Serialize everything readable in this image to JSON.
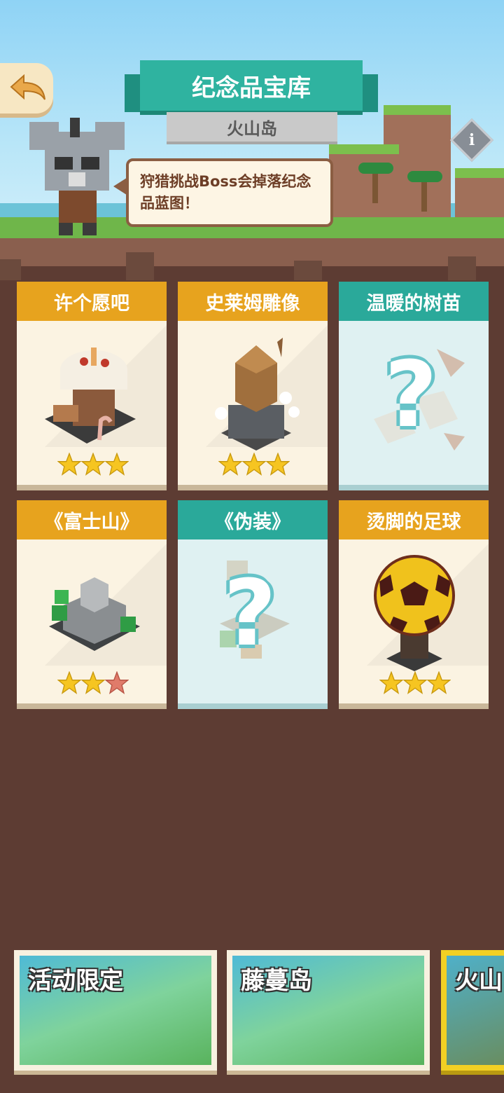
{
  "header": {
    "title": "纪念品宝库",
    "subtitle": "火山岛",
    "info_label": "i",
    "speech": "狩猎挑战Boss会掉落纪念品蓝图！"
  },
  "souvenirs": [
    {
      "name": "许个愿吧",
      "stars_earned": 3,
      "stars_total": 3,
      "locked": false,
      "header_color": "#e7a31e"
    },
    {
      "name": "史莱姆雕像",
      "stars_earned": 3,
      "stars_total": 3,
      "locked": false,
      "header_color": "#e7a31e"
    },
    {
      "name": "温暖的树苗",
      "stars_earned": 0,
      "stars_total": 0,
      "locked": true,
      "header_color": "#2aa99a",
      "placeholder": "?"
    },
    {
      "name": "《富士山》",
      "stars_earned": 2,
      "stars_total": 3,
      "locked": false,
      "header_color": "#e7a31e"
    },
    {
      "name": "《伪装》",
      "stars_earned": 0,
      "stars_total": 0,
      "locked": true,
      "header_color": "#2aa99a",
      "placeholder": "?"
    },
    {
      "name": "烫脚的足球",
      "stars_earned": 3,
      "stars_total": 3,
      "locked": false,
      "header_color": "#e7a31e"
    }
  ],
  "island_tabs": [
    {
      "label": "活动限定",
      "selected": false
    },
    {
      "label": "藤蔓岛",
      "selected": false
    },
    {
      "label": "火山",
      "selected": true
    }
  ],
  "colors": {
    "background": "#5d3c33",
    "teal": "#2fb3a0",
    "gold": "#e7a31e",
    "star": "#f6c521",
    "star_empty": "#e07b6a"
  }
}
